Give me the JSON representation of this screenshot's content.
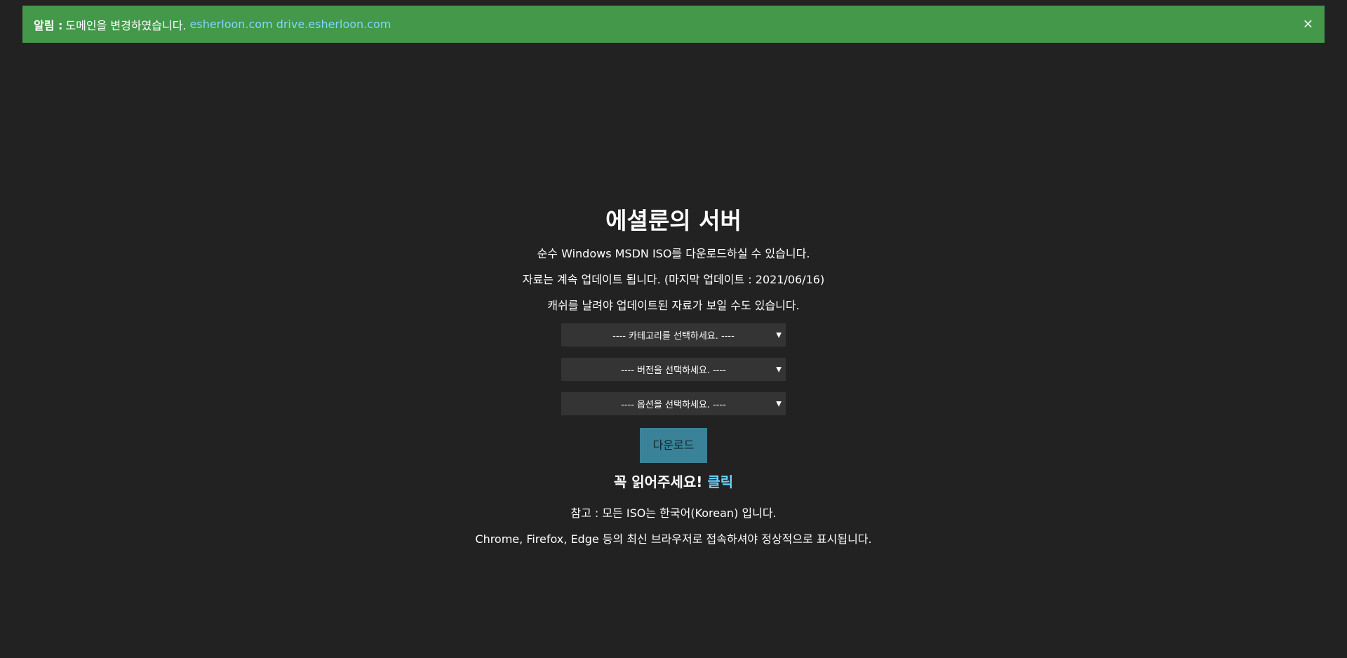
{
  "alert": {
    "label": "알림 :",
    "text": "도메인을 변경하였습니다.",
    "links": [
      "esherloon.com",
      "drive.esherloon.com"
    ],
    "close_icon": "close-icon"
  },
  "main": {
    "title": "에셜룬의 서버",
    "descriptions": [
      "순수 Windows MSDN ISO를 다운로드하실 수 있습니다.",
      "자료는 계속 업데이트 됩니다. (마지막 업데이트 : 2021/06/16)",
      "캐쉬를 날려야 업데이트된 자료가 보일 수도 있습니다."
    ],
    "selects": {
      "category": "---- 카테고리를 선택하세요. ----",
      "version": "---- 버전을 선택하세요. ----",
      "option": "---- 옵션을 선택하세요. ----"
    },
    "download_label": "다운로드",
    "read_notice": "꼭 읽어주세요!",
    "read_link": "클릭",
    "notes": [
      "참고 : 모든 ISO는 한국어(Korean) 입니다.",
      "Chrome, Firefox, Edge 등의 최신 브라우저로 접속하셔야 정상적으로 표시됩니다."
    ]
  },
  "colors": {
    "background": "#222222",
    "alert_bg": "#43984a",
    "link": "#7fd8ff",
    "button": "#3a8297",
    "select_bg": "#343434"
  }
}
